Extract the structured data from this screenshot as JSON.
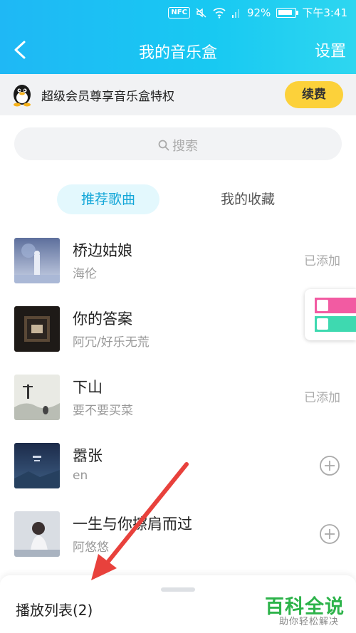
{
  "status_bar": {
    "nfc": "NFC",
    "battery": "92%",
    "time": "下午3:41",
    "battery_level": 0.92
  },
  "header": {
    "title": "我的音乐盒",
    "settings_label": "设置"
  },
  "vip_banner": {
    "text": "超级会员尊享音乐盒特权",
    "button": "续费"
  },
  "search": {
    "placeholder": "搜索"
  },
  "tabs": [
    {
      "label": "推荐歌曲",
      "active": true
    },
    {
      "label": "我的收藏",
      "active": false
    }
  ],
  "songs": [
    {
      "title": "桥边姑娘",
      "artist": "海伦",
      "status": "已添加"
    },
    {
      "title": "你的答案",
      "artist": "阿冗/好乐无荒",
      "status": ""
    },
    {
      "title": "下山",
      "artist": "要不要买菜",
      "status": "已添加"
    },
    {
      "title": "嚣张",
      "artist": "en",
      "status": ""
    },
    {
      "title": "一生与你擦肩而过",
      "artist": "阿悠悠",
      "status": ""
    }
  ],
  "bottom_sheet": {
    "playlist_label": "播放列表(2)"
  },
  "watermark": {
    "title": "百科全说",
    "subtitle": "助你轻松解决"
  },
  "colors": {
    "header": "#1fb8f5",
    "accent": "#13a6d8",
    "renew": "#fcd13a",
    "arrow": "#e8413c",
    "watermark": "#2db34a"
  }
}
